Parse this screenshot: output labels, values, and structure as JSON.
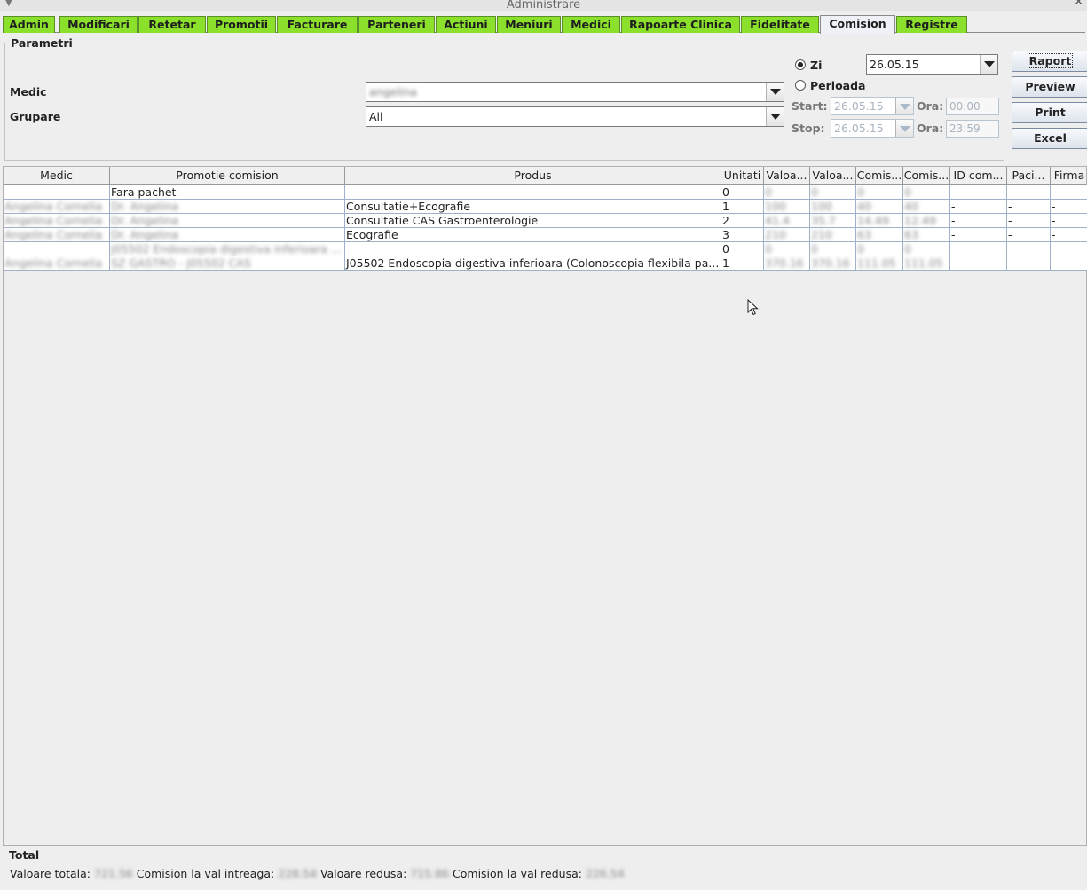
{
  "window": {
    "title": "Administrare"
  },
  "tabs": [
    "Admin",
    "Modificari",
    "Retetar",
    "Promotii",
    "Facturare",
    "Parteneri",
    "Actiuni",
    "Meniuri",
    "Medici",
    "Rapoarte Clinica",
    "Fidelitate",
    "Comision",
    "Registre"
  ],
  "active_tab": "Comision",
  "params": {
    "legend": "Parametri",
    "medic_label": "Medic",
    "medic_value": "angelina",
    "grupare_label": "Grupare",
    "grupare_value": "All",
    "zi_label": "Zi",
    "zi_date": "26.05.15",
    "perioada_label": "Perioada",
    "start_label": "Start:",
    "start_date": "26.05.15",
    "stop_label": "Stop:",
    "stop_date": "26.05.15",
    "ora_label": "Ora:",
    "ora_start": "00:00",
    "ora_stop": "23:59"
  },
  "buttons": {
    "raport": "Raport",
    "preview": "Preview",
    "print": "Print",
    "excel": "Excel"
  },
  "table": {
    "columns": [
      "Medic",
      "Promotie comision",
      "Produs",
      "Unitati",
      "Valoa...",
      "Valoa...",
      "Comis...",
      "Comis...",
      "ID com...",
      "Paci...",
      "Firma"
    ],
    "rows": [
      [
        "",
        "Fara pachet",
        "",
        "0",
        "0",
        "0",
        "0",
        "0",
        "",
        "",
        ""
      ],
      [
        "Angelina Cornelia",
        "Dr. Angelina",
        "Consultatie+Ecografie",
        "1",
        "100",
        "100",
        "40",
        "40",
        "-",
        "-",
        "-"
      ],
      [
        "Angelina Cornelia",
        "Dr. Angelina",
        "Consultatie CAS Gastroenterologie",
        "2",
        "41.4",
        "35.7",
        "14.49",
        "12.49",
        "-",
        "-",
        "-"
      ],
      [
        "Angelina Cornelia",
        "Dr. Angelina",
        "Ecografie",
        "3",
        "210",
        "210",
        "63",
        "63",
        "-",
        "-",
        "-"
      ],
      [
        "",
        "J05502 Endoscopia digestiva inferioara ...",
        "",
        "0",
        "0",
        "0",
        "0",
        "0",
        "",
        "",
        ""
      ],
      [
        "Angelina Cornelia",
        "SZ GASTRO - J05502 CAS",
        "J05502 Endoscopia digestiva inferioara (Colonoscopia flexibila pa...",
        "1",
        "370.16",
        "370.16",
        "111.05",
        "111.05",
        "-",
        "-",
        "-"
      ]
    ]
  },
  "total": {
    "legend": "Total",
    "valoare_totala_label": "Valoare totala:",
    "valoare_totala": "721.56",
    "comision_intreaga_label": "Comision la val intreaga:",
    "comision_intreaga": "228.54",
    "valoare_redusa_label": "Valoare redusa:",
    "valoare_redusa": "715.86",
    "comision_redusa_label": "Comision la val redusa:",
    "comision_redusa": "226.54"
  }
}
